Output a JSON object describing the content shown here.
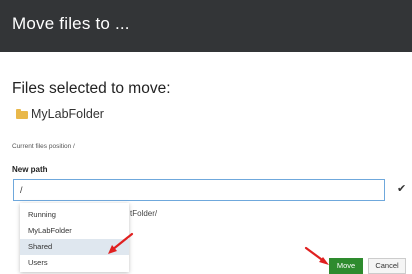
{
  "dialog": {
    "title": "Move files to ...",
    "selected_heading": "Files selected to move:",
    "selected_files": [
      "MyLabFolder"
    ],
    "current_position": "Current files position /",
    "new_path_label": "New path",
    "new_path_value": "/",
    "partial_text": "tFolder/",
    "dropdown_options": [
      "Running",
      "MyLabFolder",
      "Shared",
      "Users"
    ],
    "dropdown_highlighted": "Shared",
    "move_label": "Move",
    "cancel_label": "Cancel"
  },
  "icons": {
    "folder": "folder-icon",
    "confirm": "checkmark-icon",
    "annotation": "red-arrow"
  },
  "colors": {
    "header_bg": "#333537",
    "move_button": "#2e8b2e",
    "folder": "#e9b84a",
    "arrow": "#e02020",
    "highlight": "#dfe7ef"
  }
}
